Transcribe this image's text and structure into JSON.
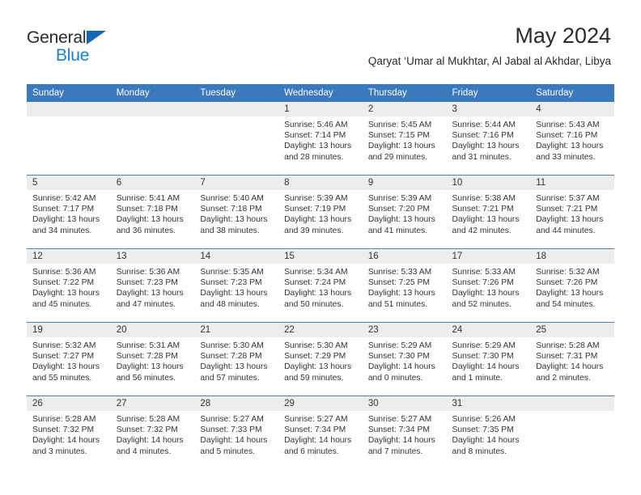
{
  "logo": {
    "word1": "General",
    "word2": "Blue",
    "triangle_color": "#1567b3",
    "blue_text_color": "#1a7fd4"
  },
  "header": {
    "title": "May 2024",
    "subtitle": "Qaryat ‘Umar al Mukhtar, Al Jabal al Akhdar, Libya"
  },
  "theme": {
    "header_row_bg": "#3a79bd",
    "day_number_bg": "#ededed",
    "row_divider": "#4a80bf",
    "text": "#333333"
  },
  "weekday_headers": [
    "Sunday",
    "Monday",
    "Tuesday",
    "Wednesday",
    "Thursday",
    "Friday",
    "Saturday"
  ],
  "weeks": [
    [
      {
        "day": "",
        "empty": true,
        "sunrise": "",
        "sunset": "",
        "daylight": ""
      },
      {
        "day": "",
        "empty": true,
        "sunrise": "",
        "sunset": "",
        "daylight": ""
      },
      {
        "day": "",
        "empty": true,
        "sunrise": "",
        "sunset": "",
        "daylight": ""
      },
      {
        "day": "1",
        "empty": false,
        "sunrise": "Sunrise: 5:46 AM",
        "sunset": "Sunset: 7:14 PM",
        "daylight": "Daylight: 13 hours and 28 minutes."
      },
      {
        "day": "2",
        "empty": false,
        "sunrise": "Sunrise: 5:45 AM",
        "sunset": "Sunset: 7:15 PM",
        "daylight": "Daylight: 13 hours and 29 minutes."
      },
      {
        "day": "3",
        "empty": false,
        "sunrise": "Sunrise: 5:44 AM",
        "sunset": "Sunset: 7:16 PM",
        "daylight": "Daylight: 13 hours and 31 minutes."
      },
      {
        "day": "4",
        "empty": false,
        "sunrise": "Sunrise: 5:43 AM",
        "sunset": "Sunset: 7:16 PM",
        "daylight": "Daylight: 13 hours and 33 minutes."
      }
    ],
    [
      {
        "day": "5",
        "empty": false,
        "sunrise": "Sunrise: 5:42 AM",
        "sunset": "Sunset: 7:17 PM",
        "daylight": "Daylight: 13 hours and 34 minutes."
      },
      {
        "day": "6",
        "empty": false,
        "sunrise": "Sunrise: 5:41 AM",
        "sunset": "Sunset: 7:18 PM",
        "daylight": "Daylight: 13 hours and 36 minutes."
      },
      {
        "day": "7",
        "empty": false,
        "sunrise": "Sunrise: 5:40 AM",
        "sunset": "Sunset: 7:18 PM",
        "daylight": "Daylight: 13 hours and 38 minutes."
      },
      {
        "day": "8",
        "empty": false,
        "sunrise": "Sunrise: 5:39 AM",
        "sunset": "Sunset: 7:19 PM",
        "daylight": "Daylight: 13 hours and 39 minutes."
      },
      {
        "day": "9",
        "empty": false,
        "sunrise": "Sunrise: 5:39 AM",
        "sunset": "Sunset: 7:20 PM",
        "daylight": "Daylight: 13 hours and 41 minutes."
      },
      {
        "day": "10",
        "empty": false,
        "sunrise": "Sunrise: 5:38 AM",
        "sunset": "Sunset: 7:21 PM",
        "daylight": "Daylight: 13 hours and 42 minutes."
      },
      {
        "day": "11",
        "empty": false,
        "sunrise": "Sunrise: 5:37 AM",
        "sunset": "Sunset: 7:21 PM",
        "daylight": "Daylight: 13 hours and 44 minutes."
      }
    ],
    [
      {
        "day": "12",
        "empty": false,
        "sunrise": "Sunrise: 5:36 AM",
        "sunset": "Sunset: 7:22 PM",
        "daylight": "Daylight: 13 hours and 45 minutes."
      },
      {
        "day": "13",
        "empty": false,
        "sunrise": "Sunrise: 5:36 AM",
        "sunset": "Sunset: 7:23 PM",
        "daylight": "Daylight: 13 hours and 47 minutes."
      },
      {
        "day": "14",
        "empty": false,
        "sunrise": "Sunrise: 5:35 AM",
        "sunset": "Sunset: 7:23 PM",
        "daylight": "Daylight: 13 hours and 48 minutes."
      },
      {
        "day": "15",
        "empty": false,
        "sunrise": "Sunrise: 5:34 AM",
        "sunset": "Sunset: 7:24 PM",
        "daylight": "Daylight: 13 hours and 50 minutes."
      },
      {
        "day": "16",
        "empty": false,
        "sunrise": "Sunrise: 5:33 AM",
        "sunset": "Sunset: 7:25 PM",
        "daylight": "Daylight: 13 hours and 51 minutes."
      },
      {
        "day": "17",
        "empty": false,
        "sunrise": "Sunrise: 5:33 AM",
        "sunset": "Sunset: 7:26 PM",
        "daylight": "Daylight: 13 hours and 52 minutes."
      },
      {
        "day": "18",
        "empty": false,
        "sunrise": "Sunrise: 5:32 AM",
        "sunset": "Sunset: 7:26 PM",
        "daylight": "Daylight: 13 hours and 54 minutes."
      }
    ],
    [
      {
        "day": "19",
        "empty": false,
        "sunrise": "Sunrise: 5:32 AM",
        "sunset": "Sunset: 7:27 PM",
        "daylight": "Daylight: 13 hours and 55 minutes."
      },
      {
        "day": "20",
        "empty": false,
        "sunrise": "Sunrise: 5:31 AM",
        "sunset": "Sunset: 7:28 PM",
        "daylight": "Daylight: 13 hours and 56 minutes."
      },
      {
        "day": "21",
        "empty": false,
        "sunrise": "Sunrise: 5:30 AM",
        "sunset": "Sunset: 7:28 PM",
        "daylight": "Daylight: 13 hours and 57 minutes."
      },
      {
        "day": "22",
        "empty": false,
        "sunrise": "Sunrise: 5:30 AM",
        "sunset": "Sunset: 7:29 PM",
        "daylight": "Daylight: 13 hours and 59 minutes."
      },
      {
        "day": "23",
        "empty": false,
        "sunrise": "Sunrise: 5:29 AM",
        "sunset": "Sunset: 7:30 PM",
        "daylight": "Daylight: 14 hours and 0 minutes."
      },
      {
        "day": "24",
        "empty": false,
        "sunrise": "Sunrise: 5:29 AM",
        "sunset": "Sunset: 7:30 PM",
        "daylight": "Daylight: 14 hours and 1 minute."
      },
      {
        "day": "25",
        "empty": false,
        "sunrise": "Sunrise: 5:28 AM",
        "sunset": "Sunset: 7:31 PM",
        "daylight": "Daylight: 14 hours and 2 minutes."
      }
    ],
    [
      {
        "day": "26",
        "empty": false,
        "sunrise": "Sunrise: 5:28 AM",
        "sunset": "Sunset: 7:32 PM",
        "daylight": "Daylight: 14 hours and 3 minutes."
      },
      {
        "day": "27",
        "empty": false,
        "sunrise": "Sunrise: 5:28 AM",
        "sunset": "Sunset: 7:32 PM",
        "daylight": "Daylight: 14 hours and 4 minutes."
      },
      {
        "day": "28",
        "empty": false,
        "sunrise": "Sunrise: 5:27 AM",
        "sunset": "Sunset: 7:33 PM",
        "daylight": "Daylight: 14 hours and 5 minutes."
      },
      {
        "day": "29",
        "empty": false,
        "sunrise": "Sunrise: 5:27 AM",
        "sunset": "Sunset: 7:34 PM",
        "daylight": "Daylight: 14 hours and 6 minutes."
      },
      {
        "day": "30",
        "empty": false,
        "sunrise": "Sunrise: 5:27 AM",
        "sunset": "Sunset: 7:34 PM",
        "daylight": "Daylight: 14 hours and 7 minutes."
      },
      {
        "day": "31",
        "empty": false,
        "sunrise": "Sunrise: 5:26 AM",
        "sunset": "Sunset: 7:35 PM",
        "daylight": "Daylight: 14 hours and 8 minutes."
      },
      {
        "day": "",
        "empty": true,
        "sunrise": "",
        "sunset": "",
        "daylight": ""
      }
    ]
  ]
}
